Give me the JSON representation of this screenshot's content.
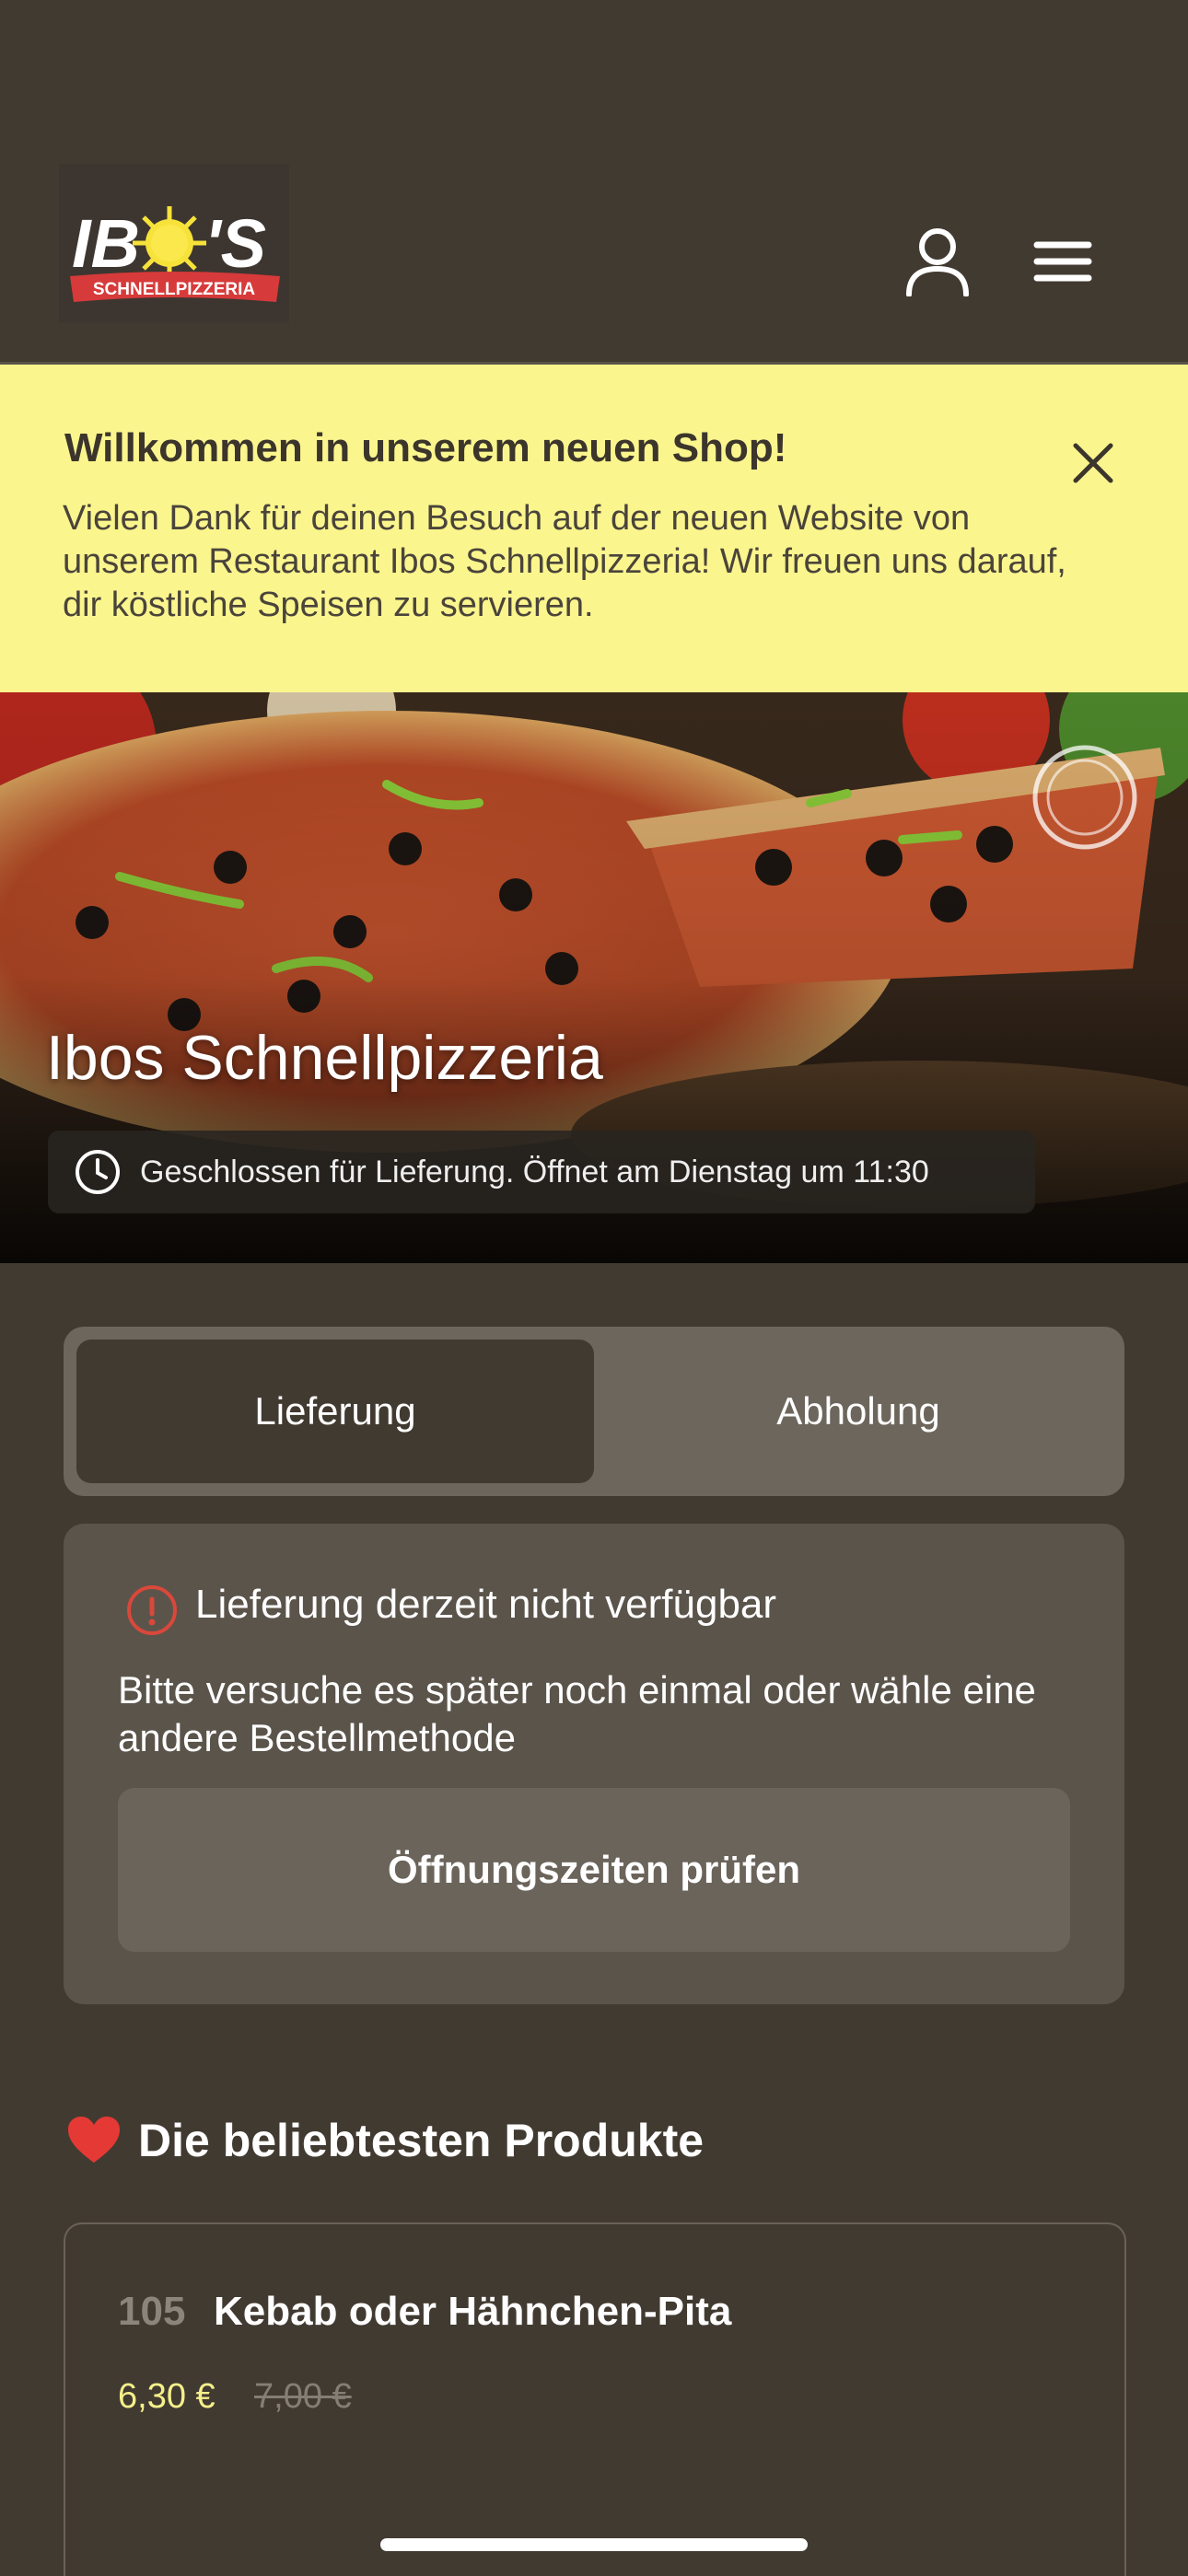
{
  "header": {
    "logo_text": "IBO'S",
    "logo_subtitle": "SCHNELLPIZZERIA"
  },
  "banner": {
    "title": "Willkommen in unserem neuen Shop!",
    "text": "Vielen Dank für deinen Besuch auf der neuen Website von unserem Restaurant Ibos Schnellpizzeria! Wir freuen uns darauf, dir köstliche Speisen zu servieren."
  },
  "hero": {
    "restaurant_name": "Ibos Schnellpizzeria",
    "status": "Geschlossen für Lieferung. Öffnet am Dienstag um 11:30"
  },
  "order_mode": {
    "options": [
      "Lieferung",
      "Abholung"
    ],
    "selected": "Lieferung"
  },
  "notice": {
    "title": "Lieferung derzeit nicht verfügbar",
    "text": "Bitte versuche es später noch einmal oder wähle eine andere Bestellmethode",
    "button_label": "Öffnungszeiten prüfen"
  },
  "popular": {
    "heading": "Die beliebtesten Produkte",
    "items": [
      {
        "number": "105",
        "name": "Kebab oder Hähnchen-Pita",
        "price": "6,30 €",
        "old_price": "7,00 €"
      }
    ]
  },
  "colors": {
    "background": "#413a31",
    "banner": "#fbf58e",
    "card": "#5b544b",
    "price": "#f5f08a",
    "alert": "#d9483b"
  }
}
